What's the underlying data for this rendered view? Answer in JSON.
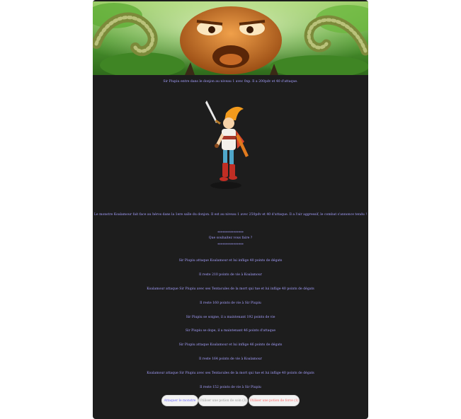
{
  "story": {
    "intro": "Sir Piupiu entre dans le donjon au niveau 1 avec 0xp. Il a 200pdv et 40 d'attaque.",
    "monster_intro": "Le monstre Koalamour fait face au héros dans la 1ere salle du donjon. Il est au niveau 1 avec 250pdv et 40 d'attaque. Il a l'air aggressif, le combat s'annonce tendu !",
    "separator_top": "****************",
    "prompt": "Que souhaitez vous faire ?",
    "separator_bottom": "****************"
  },
  "log": [
    "Sir Piupiu attaque Koalamour et lui inflige 40 points de dégats",
    "Il reste 210 points de vie à Koalamour",
    "Koalamour attaque Sir Piupiu avec ses Tentacules de la mort qui tue et lui inflige 40 points de dégats",
    "Il reste 160 points de vie à Sir Piupiu",
    "Sir Piupiu se soigne, il a maintenant 192 points de vie",
    "Sir Piupiu se dope, il a maintenant 46 points d'attaque",
    "Sir Piupiu attaque Koalamour et lui inflige 46 points de dégats",
    "Il reste 164 points de vie à Koalamour",
    "Koalamour attaque Sir Piupiu avec ses Tentacules de la mort qui tue et lui inflige 40 points de dégats",
    "Il reste 152 points de vie à Sir Piupiu"
  ],
  "actions": {
    "attack": "Attaquer le monstre",
    "heal": "Utiliser une potion de soin (3)",
    "strength": "Utiliser une potion de force (1)"
  },
  "colors": {
    "text": "#a6a0ff",
    "panel": "#1d1d1d",
    "attack": "#6f6cff",
    "heal": "#9a9a9a",
    "strength": "#ff6a6a"
  }
}
